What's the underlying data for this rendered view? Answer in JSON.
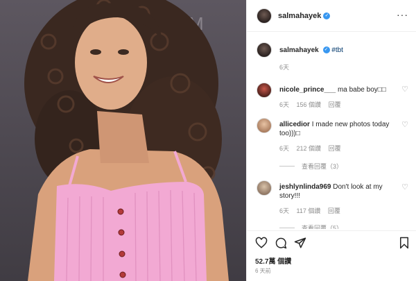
{
  "header": {
    "username": "salmahayek"
  },
  "caption": {
    "username": "salmahayek",
    "hashtag": "#tbt",
    "time": "6天"
  },
  "comments": [
    {
      "username": "nicole_prince___",
      "text": "ma babe boy□□",
      "time": "6天",
      "likes": "156 個讚",
      "reply": "回覆"
    },
    {
      "username": "allicedior",
      "text": "I made new photos today too)))□",
      "time": "6天",
      "likes": "212 個讚",
      "reply": "回覆"
    },
    {
      "username": "jeshlynlinda969",
      "text": "Don't look at my story!!!",
      "time": "6天",
      "likes": "117 個讚",
      "reply": "回覆"
    }
  ],
  "view_replies_1": "查看回覆（3）",
  "view_replies_2": "查看回覆（5）",
  "footer": {
    "likes": "52.7萬 個讚",
    "time": "6 天前"
  },
  "colors": {
    "verified": "#3897f0",
    "hashtag": "#00376b",
    "dress": "#f2a9d3"
  },
  "icons": [
    "more-icon",
    "heart-icon",
    "comment-icon",
    "share-icon",
    "bookmark-icon"
  ]
}
